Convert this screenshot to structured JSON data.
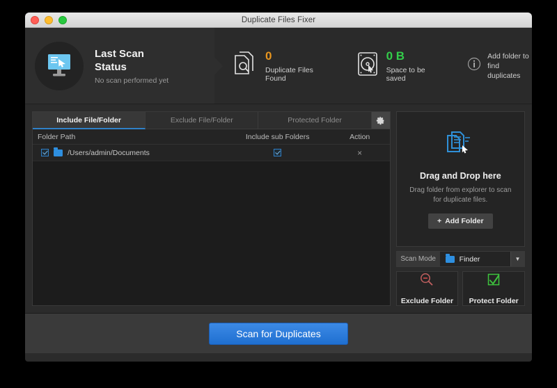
{
  "window": {
    "title": "Duplicate Files Fixer",
    "traffic_lights": [
      "close",
      "minimize",
      "zoom"
    ]
  },
  "header": {
    "status": {
      "icon": "monitor-icon",
      "title_line1": "Last Scan",
      "title_line2": "Status",
      "subtitle": "No scan performed yet"
    },
    "stats": [
      {
        "icon": "document-search-icon",
        "value": "0",
        "label": "Duplicate Files Found",
        "color": "#e8951e"
      },
      {
        "icon": "hard-disk-search-icon",
        "value": "0 B",
        "label": "Space to be saved",
        "color": "#33cc4a"
      }
    ],
    "info": {
      "icon": "info-icon",
      "line1": "Add folder to",
      "line2": "find duplicates"
    }
  },
  "main": {
    "tabs": [
      {
        "label": "Include File/Folder",
        "active": true
      },
      {
        "label": "Exclude File/Folder",
        "active": false
      },
      {
        "label": "Protected Folder",
        "active": false
      }
    ],
    "settings_icon": "gear-icon",
    "columns": {
      "path": "Folder Path",
      "subfolders": "Include sub Folders",
      "action": "Action"
    },
    "rows": [
      {
        "checked": true,
        "icon": "folder-icon",
        "path": "/Users/admin/Documents",
        "include_subfolders": true,
        "action": "×"
      }
    ]
  },
  "sidebar": {
    "dropzone": {
      "icon": "documents-cursor-icon",
      "title": "Drag and Drop here",
      "description": "Drag folder from explorer to scan for duplicate files.",
      "add_button": "Add Folder",
      "add_button_icon": "plus-icon"
    },
    "scan_mode": {
      "label": "Scan Mode",
      "selected": "Finder",
      "icon": "folder-icon",
      "caret": "chevron-down-icon",
      "options": [
        "Finder"
      ]
    },
    "actions": [
      {
        "icon": "magnifier-minus-icon",
        "label": "Exclude Folder",
        "color": "#c45050"
      },
      {
        "icon": "green-check-icon",
        "label": "Protect Folder",
        "color": "#3ec43e"
      }
    ]
  },
  "footer": {
    "scan_button": "Scan for Duplicates",
    "accent": "#2f7fe0"
  }
}
